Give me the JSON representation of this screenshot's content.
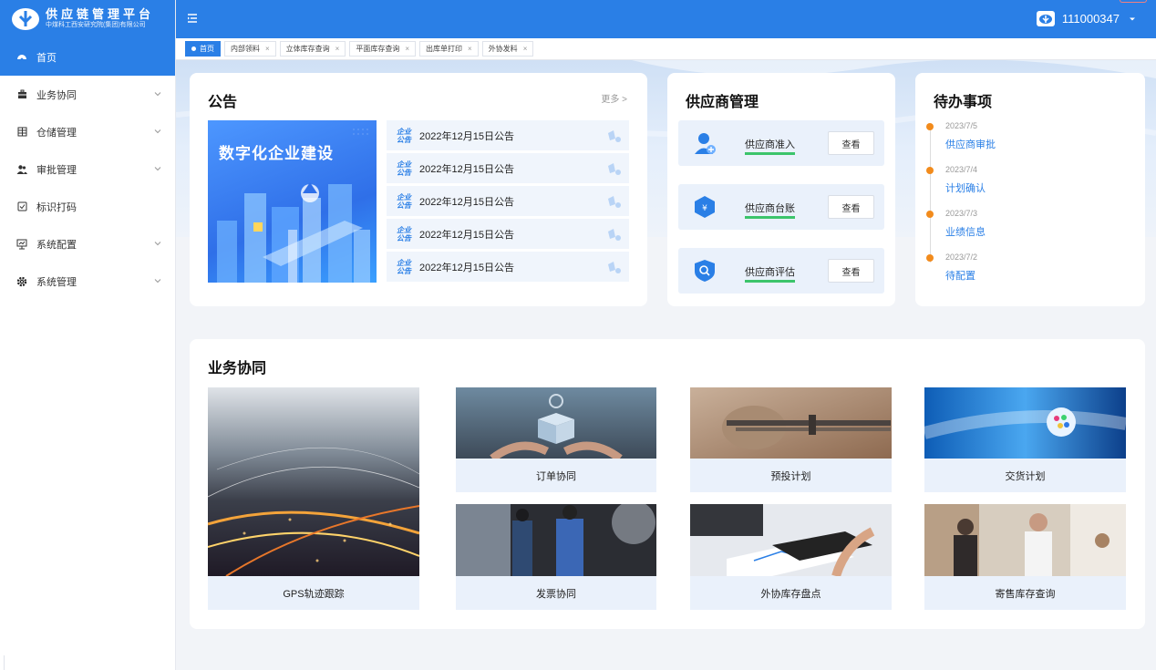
{
  "brand": {
    "title": "供应链管理平台",
    "subtitle": "中煤科工西安研究院(集团)有限公司"
  },
  "sidebar": {
    "items": [
      {
        "label": "首页",
        "icon": "dashboard-icon",
        "active": true,
        "expandable": false
      },
      {
        "label": "业务协同",
        "icon": "briefcase-icon",
        "expandable": true
      },
      {
        "label": "仓储管理",
        "icon": "grid-icon",
        "expandable": true
      },
      {
        "label": "审批管理",
        "icon": "users-icon",
        "expandable": true
      },
      {
        "label": "标识打码",
        "icon": "checkbox-icon",
        "expandable": false
      },
      {
        "label": "系统配置",
        "icon": "monitor-icon",
        "expandable": true
      },
      {
        "label": "系统管理",
        "icon": "gear-icon",
        "expandable": true
      }
    ]
  },
  "header": {
    "username": "111000347"
  },
  "tabs": [
    {
      "label": "首页",
      "active": true,
      "closable": false
    },
    {
      "label": "内部领料",
      "closable": true
    },
    {
      "label": "立体库存查询",
      "closable": true
    },
    {
      "label": "平面库存查询",
      "closable": true
    },
    {
      "label": "出库单打印",
      "closable": true
    },
    {
      "label": "外协发料",
      "closable": true
    }
  ],
  "notice": {
    "title": "公告",
    "more": "更多 >",
    "image_caption": "数字化企业建设",
    "tag_line1": "企业",
    "tag_line2": "公告",
    "items": [
      "2022年12月15日公告",
      "2022年12月15日公告",
      "2022年12月15日公告",
      "2022年12月15日公告",
      "2022年12月15日公告"
    ]
  },
  "supplier": {
    "title": "供应商管理",
    "view_label": "查看",
    "items": [
      {
        "label": "供应商准入",
        "icon": "user-add-icon"
      },
      {
        "label": "供应商台账",
        "icon": "ledger-shield-icon"
      },
      {
        "label": "供应商评估",
        "icon": "search-shield-icon"
      }
    ]
  },
  "todo": {
    "title": "待办事项",
    "items": [
      {
        "date": "2023/7/5",
        "label": "供应商审批"
      },
      {
        "date": "2023/7/4",
        "label": "计划确认"
      },
      {
        "date": "2023/7/3",
        "label": "业绩信息"
      },
      {
        "date": "2023/7/2",
        "label": "待配置"
      }
    ]
  },
  "business": {
    "title": "业务协同",
    "tiles": [
      "GPS轨迹跟踪",
      "订单协同",
      "预投计划",
      "交货计划",
      "发票协同",
      "外协库存盘点",
      "寄售库存查询"
    ]
  },
  "colors": {
    "primary": "#2a7fe6",
    "accent_orange": "#f28b1c",
    "underline_green": "#3cc46b"
  }
}
